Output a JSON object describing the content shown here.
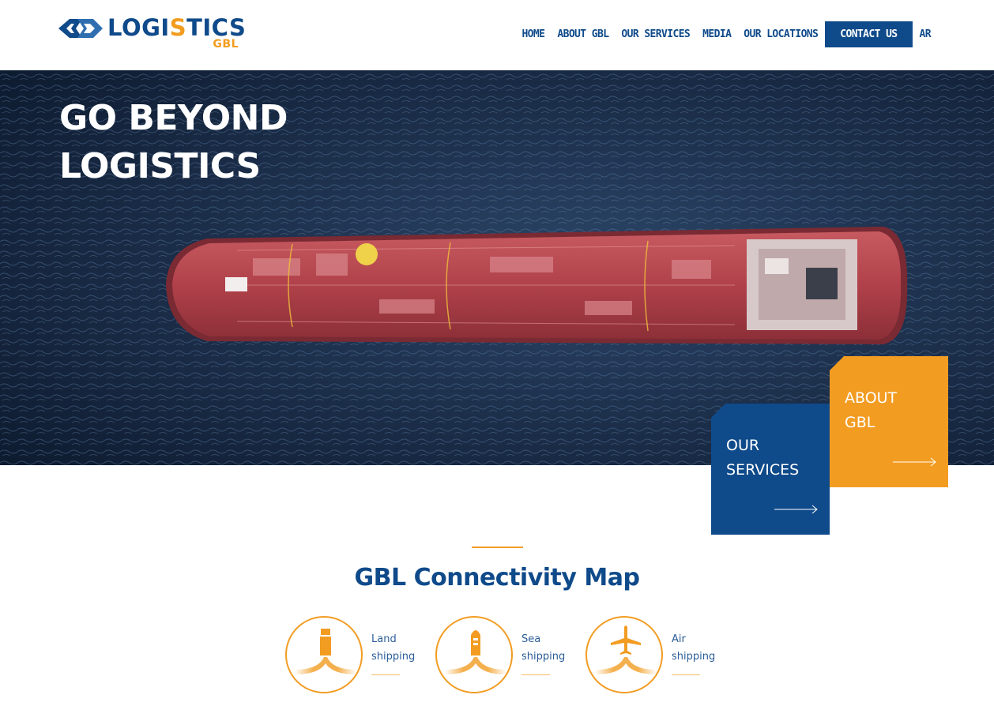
{
  "brand": {
    "logo_main_prefix": "LOGI",
    "logo_main_accent": "S",
    "logo_main_suffix": "TICS",
    "logo_sub": "GBL",
    "colors": {
      "primary": "#0f4a8a",
      "accent": "#f29c22"
    }
  },
  "nav": {
    "items": [
      {
        "label": "HOME"
      },
      {
        "label": "ABOUT GBL"
      },
      {
        "label": "OUR SERVICES"
      },
      {
        "label": "MEDIA"
      },
      {
        "label": "OUR LOCATIONS"
      }
    ],
    "contact_label": "CONTACT US",
    "lang_label": "AR"
  },
  "hero": {
    "title_line1": "GO BEYOND",
    "title_line2": "LOGISTICS",
    "image": "aerial view of red cargo tanker ship on dark blue sea"
  },
  "cards": {
    "about_line1": "ABOUT",
    "about_line2": "GBL",
    "services_line1": "OUR",
    "services_line2": "SERVICES",
    "arrow_icon": "long-right-arrow-icon"
  },
  "connectivity": {
    "title": "GBL Connectivity Map",
    "modes": [
      {
        "line1": "Land",
        "line2": "shipping",
        "icon": "truck-icon"
      },
      {
        "line1": "Sea",
        "line2": "shipping",
        "icon": "ship-icon"
      },
      {
        "line1": "Air",
        "line2": "shipping",
        "icon": "airplane-icon"
      }
    ]
  }
}
